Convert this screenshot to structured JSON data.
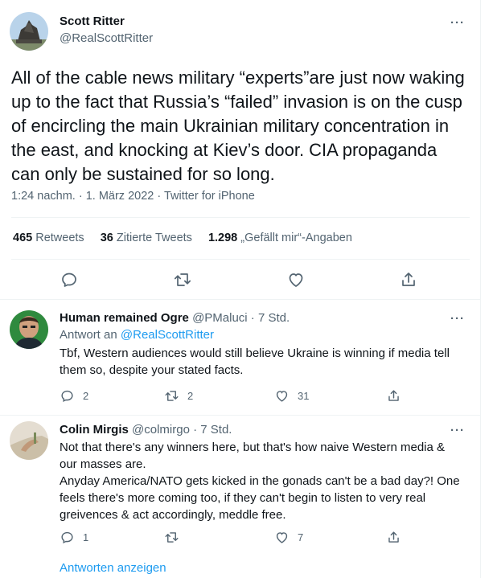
{
  "tweet": {
    "author_name": "Scott Ritter",
    "author_handle": "@RealScottRitter",
    "more": "···",
    "text": "All of the cable news military “experts”are just now waking up to the fact that Russia’s “failed” invasion is on the cusp of encircling the main Ukrainian military concentration in the east, and knocking at Kiev’s door. CIA propaganda can only be sustained for so long.",
    "time": "1:24 nachm.",
    "date": "1. März 2022",
    "source": "Twitter for iPhone",
    "retweets_count": "465",
    "retweets_label": "Retweets",
    "quotes_count": "36",
    "quotes_label": "Zitierte Tweets",
    "likes_count": "1.298",
    "likes_label": "„Gefällt mir“-Angaben"
  },
  "replies": [
    {
      "author_name": "Human remained Ogre",
      "author_handle": "@PMaluci",
      "age": "7 Std.",
      "replying_to_prefix": "Antwort an",
      "replying_to_handle": "@RealScottRitter",
      "text": "Tbf, Western audiences would still believe Ukraine is winning if media tell them so, despite your stated facts.",
      "reply_count": "2",
      "retweet_count": "2",
      "like_count": "31"
    },
    {
      "author_name": "Colin Mirgis",
      "author_handle": "@colmirgo",
      "age": "7 Std.",
      "text_line1": "Not that there's any winners here, but that's how naive Western media & our masses are.",
      "text_line2": "Anyday America/NATO gets kicked in the gonads can't be a bad day?! One feels there's more coming too, if they can't begin to listen to very real greivences & act accordingly, meddle free.",
      "reply_count": "1",
      "retweet_count": "",
      "like_count": "7"
    }
  ],
  "show_replies_label": "Antworten anzeigen",
  "dot": " · ",
  "icons": [
    "reply-icon",
    "retweet-icon",
    "like-icon",
    "share-icon"
  ],
  "colors": {
    "link": "#1d9bf0",
    "muted": "#536471",
    "text": "#0f1419",
    "divider": "#eff3f4"
  }
}
